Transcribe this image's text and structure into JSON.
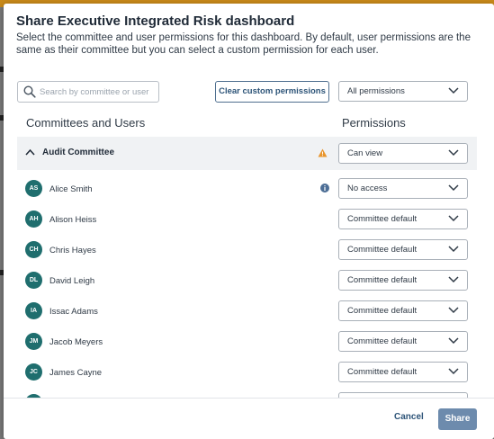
{
  "dialog": {
    "title": "Share Executive Integrated Risk dashboard",
    "description": "Select the committee and user permissions for this dashboard. By default, user permissions are the same as their committee but you can select a custom permission for each user."
  },
  "toolbar": {
    "search_placeholder": "Search by committee or user",
    "clear_button": "Clear custom permissions",
    "permissions_filter": "All permissions"
  },
  "columns": {
    "left": "Committees and Users",
    "right": "Permissions"
  },
  "group": {
    "name": "Audit Committee",
    "permission": "Can view",
    "warning_icon": "warning-triangle-icon",
    "warning_color": "#e8952c"
  },
  "users": [
    {
      "initials": "AS",
      "name": "Alice Smith",
      "permission": "No access",
      "info_icon": true
    },
    {
      "initials": "AH",
      "name": "Alison Heiss",
      "permission": "Committee default"
    },
    {
      "initials": "CH",
      "name": "Chris Hayes",
      "permission": "Committee default"
    },
    {
      "initials": "DL",
      "name": "David Leigh",
      "permission": "Committee default"
    },
    {
      "initials": "IA",
      "name": "Issac Adams",
      "permission": "Committee default"
    },
    {
      "initials": "JM",
      "name": "Jacob Meyers",
      "permission": "Committee default"
    },
    {
      "initials": "JC",
      "name": "James Cayne",
      "permission": "Committee default"
    }
  ],
  "footer": {
    "cancel": "Cancel",
    "share": "Share"
  },
  "colors": {
    "avatar": "#1f6e6e",
    "accent": "#2d5478",
    "share_button": "#6d8bad"
  }
}
